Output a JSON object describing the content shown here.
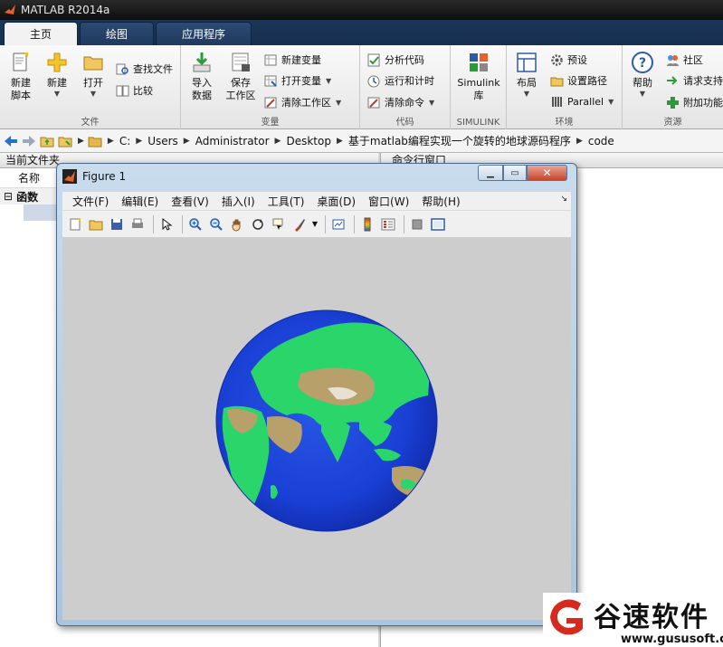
{
  "app": {
    "title": "MATLAB R2014a"
  },
  "tabs": [
    {
      "label": "主页"
    },
    {
      "label": "绘图"
    },
    {
      "label": "应用程序"
    }
  ],
  "ribbon": {
    "file": {
      "group_label": "文件",
      "new_script": "新建\n脚本",
      "new": "新建",
      "open": "打开",
      "find_files": "查找文件",
      "compare": "比较"
    },
    "variable": {
      "group_label": "变量",
      "import_data": "导入\n数据",
      "save_workspace": "保存\n工作区",
      "new_variable": "新建变量",
      "open_variable": "打开变量",
      "clear_workspace": "清除工作区"
    },
    "code": {
      "group_label": "代码",
      "analyze_code": "分析代码",
      "run_and_time": "运行和计时",
      "clear_commands": "清除命令"
    },
    "simulink": {
      "group_label": "SIMULINK",
      "simulink_library": "Simulink\n库"
    },
    "environment": {
      "group_label": "环境",
      "layout": "布局",
      "preferences": "预设",
      "set_path": "设置路径",
      "parallel": "Parallel"
    },
    "resources": {
      "group_label": "资源",
      "help": "帮助",
      "community": "社区",
      "request_support": "请求支持",
      "add_ons": "附加功能"
    }
  },
  "address": {
    "crumbs": [
      "C:",
      "Users",
      "Administrator",
      "Desktop",
      "基于matlab编程实现一个旋转的地球源码程序",
      "code"
    ]
  },
  "left_panel": {
    "title": "当前文件夹",
    "column_name": "名称",
    "group": "函数"
  },
  "right_panel": {
    "title": "命令行窗口"
  },
  "figure": {
    "title": "Figure 1",
    "menu": [
      "文件(F)",
      "编辑(E)",
      "查看(V)",
      "插入(I)",
      "工具(T)",
      "桌面(D)",
      "窗口(W)",
      "帮助(H)"
    ],
    "toolbar_icons": [
      "new-figure-icon",
      "open-file-icon",
      "save-figure-icon",
      "print-figure-icon",
      "edit-plot-icon",
      "zoom-in-icon",
      "zoom-out-icon",
      "pan-icon",
      "rotate-3d-icon",
      "data-cursor-icon",
      "brush-icon",
      "link-plot-icon",
      "colorbar-icon",
      "legend-icon",
      "hide-plot-tools-icon",
      "show-plot-tools-icon"
    ]
  },
  "watermark": {
    "name": "谷速软件",
    "url": "www.gususoft.com"
  },
  "colors": {
    "ocean": "#1a3fd4",
    "land_green": "#2ad66a",
    "land_tan": "#b8a06a",
    "canvas": "#cdcdcd",
    "ribbon_dark": "#1d3557"
  }
}
